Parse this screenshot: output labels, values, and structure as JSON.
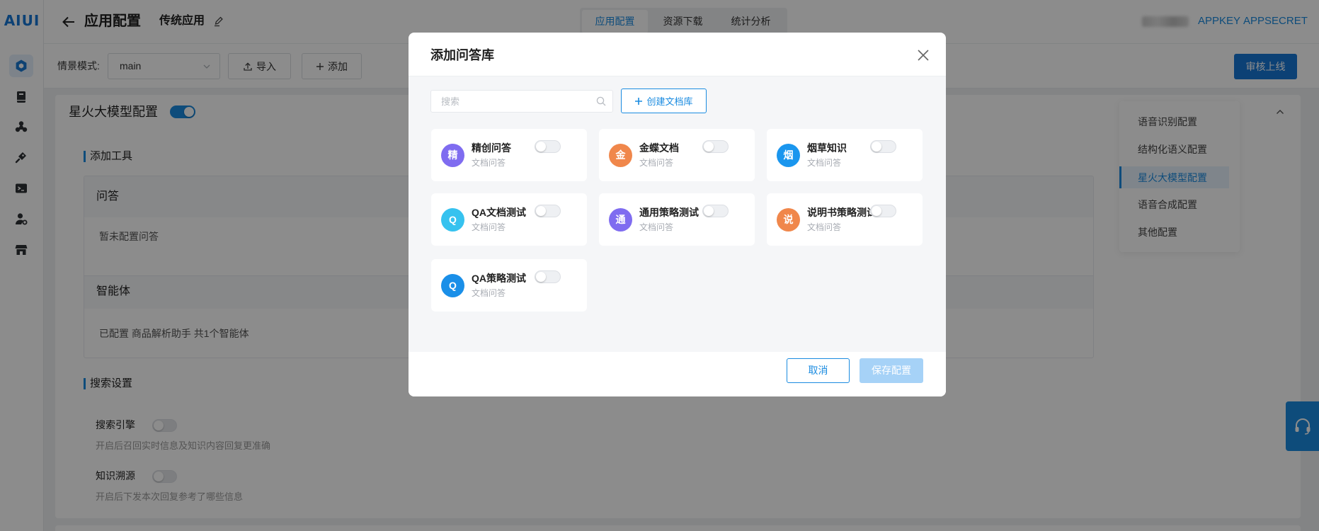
{
  "logo": "AIUI",
  "sidebar": {
    "items": [
      {
        "icon": "app-config-icon",
        "active": true
      },
      {
        "icon": "book-icon",
        "active": false
      },
      {
        "icon": "skill-icon",
        "active": false
      },
      {
        "icon": "plugin-icon",
        "active": false
      },
      {
        "icon": "terminal-icon",
        "active": false
      },
      {
        "icon": "user-settings-icon",
        "active": false
      },
      {
        "icon": "store-icon",
        "active": false
      }
    ]
  },
  "header": {
    "title": "应用配置",
    "app_name": "传统应用",
    "tabs": [
      {
        "label": "应用配置",
        "active": true
      },
      {
        "label": "资源下载",
        "active": false
      },
      {
        "label": "统计分析",
        "active": false
      }
    ],
    "appkey": "APPKEY",
    "appsecret": "APPSECRET"
  },
  "toolbar": {
    "scene_label": "情景模式:",
    "scene_value": "main",
    "import_label": "导入",
    "add_label": "添加",
    "publish_label": "审核上线"
  },
  "main": {
    "section_title": "星火大模型配置",
    "section_enabled": true,
    "tools_heading": "添加工具",
    "qa_title": "问答",
    "qa_content": "暂未配置问答",
    "agent_title": "智能体",
    "agent_content": "已配置 商品解析助手 共1个智能体",
    "search_heading": "搜索设置",
    "search_engine": {
      "label": "搜索引擎",
      "enabled": false,
      "desc": "开启后召回实时信息及知识内容回复更准确"
    },
    "knowledge_trace": {
      "label": "知识溯源",
      "enabled": false,
      "desc": "开启后下发本次回复参考了哪些信息"
    }
  },
  "right_nav": {
    "items": [
      {
        "label": "语音识别配置",
        "active": false
      },
      {
        "label": "结构化语义配置",
        "active": false
      },
      {
        "label": "星火大模型配置",
        "active": true
      },
      {
        "label": "语音合成配置",
        "active": false
      },
      {
        "label": "其他配置",
        "active": false
      }
    ]
  },
  "modal": {
    "title": "添加问答库",
    "search_placeholder": "搜索",
    "create_label": "创建文档库",
    "cards": [
      {
        "avatar": "精",
        "title": "精创问答",
        "subtitle": "文档问答",
        "color": "#7f6cf0",
        "enabled": false
      },
      {
        "avatar": "金",
        "title": "金蝶文档",
        "subtitle": "文档问答",
        "color": "#f0874b",
        "enabled": false
      },
      {
        "avatar": "烟",
        "title": "烟草知识",
        "subtitle": "文档问答",
        "color": "#1a96ee",
        "enabled": false
      },
      {
        "avatar": "Q",
        "title": "QA文档测试",
        "subtitle": "文档问答",
        "color": "#36c2ef",
        "enabled": false
      },
      {
        "avatar": "通",
        "title": "通用策略测试",
        "subtitle": "文档问答",
        "color": "#7f6cf0",
        "enabled": false
      },
      {
        "avatar": "说",
        "title": "说明书策略测试",
        "subtitle": "文档问答",
        "color": "#f0874b",
        "enabled": false
      },
      {
        "avatar": "Q",
        "title": "QA策略测试",
        "subtitle": "文档问答",
        "color": "#1a8fe8",
        "enabled": false
      }
    ],
    "cancel_label": "取消",
    "save_label": "保存配置"
  },
  "colors": {
    "accent": "#1a8be0",
    "primary_button": "#1677d6",
    "disabled_button": "#a6d2f7",
    "overlay": "rgba(0,0,0,0.45)"
  }
}
